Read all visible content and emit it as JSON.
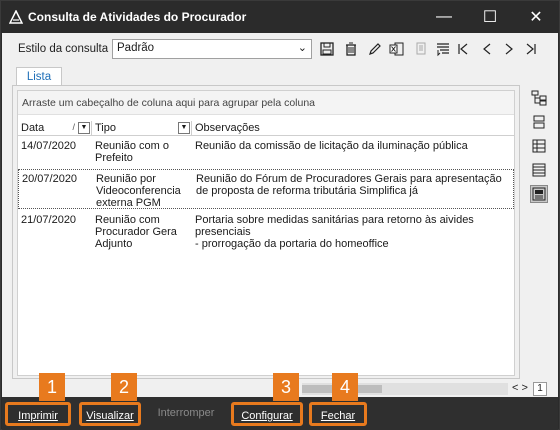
{
  "window": {
    "title": "Consulta de Atividades do Procurador",
    "controls": {
      "minimize": "—",
      "maximize": "☐",
      "close": "✕"
    }
  },
  "toolbar": {
    "style_label": "Estilo da consulta",
    "style_value": "Padrão",
    "icons": [
      "save-icon",
      "delete-icon",
      "edit-icon",
      "excel-export-icon",
      "copy-icon",
      "filter-config-icon",
      "first-icon",
      "prev-icon",
      "next-icon",
      "last-icon"
    ]
  },
  "tabs": [
    {
      "label": "Lista"
    }
  ],
  "grid": {
    "group_hint": "Arraste um cabeçalho de coluna aqui para agrupar pela coluna",
    "columns": [
      {
        "label": "Data",
        "sort": "/"
      },
      {
        "label": "Tipo"
      },
      {
        "label": "Observações"
      }
    ],
    "rows": [
      {
        "data": "14/07/2020",
        "tipo": "Reunião com o Prefeito",
        "obs": "Reunião da comissão de licitação da iluminação pública"
      },
      {
        "data": "20/07/2020",
        "tipo": "Reunião por Videoconferencia externa PGM",
        "obs": "Reunião do Fórum de Procuradores Gerais para apresentação de proposta de reforma tributária Simplifica já"
      },
      {
        "data": "21/07/2020",
        "tipo": "Reunião com Procurador Gera Adjunto",
        "obs": "Portaria sobre medidas sanitárias para retorno às aivides presenciais\n- prorrogação da portaria do homeoffice"
      }
    ]
  },
  "pager": {
    "prev": "<",
    "next": ">",
    "page": "1"
  },
  "buttons": {
    "print": "Imprimir",
    "view": "Visualizar",
    "interrupt": "Interromper",
    "configure": "Configurar",
    "close": "Fechar"
  },
  "badges": [
    "1",
    "2",
    "3",
    "4"
  ],
  "colors": {
    "accent": "#e87a1e",
    "tab_text": "#1e6fb8",
    "titlebar": "#2b2b2b"
  }
}
